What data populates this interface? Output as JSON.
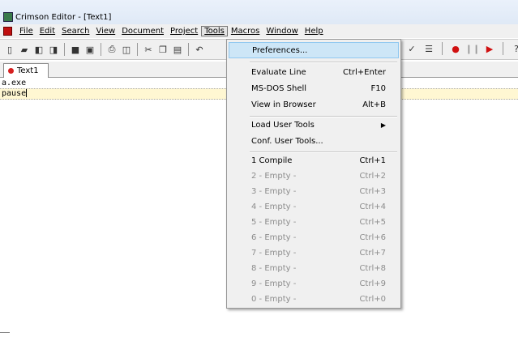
{
  "window": {
    "title": "Crimson Editor - [Text1]"
  },
  "menubar": {
    "items": [
      "File",
      "Edit",
      "Search",
      "View",
      "Document",
      "Project",
      "Tools",
      "Macros",
      "Window",
      "Help"
    ]
  },
  "tab": {
    "label": "Text1"
  },
  "editor": {
    "lines": [
      "a.exe",
      "pause"
    ]
  },
  "tools_menu": {
    "items": [
      {
        "label": "Preferences...",
        "shortcut": ""
      },
      {
        "label": "Evaluate Line",
        "shortcut": "Ctrl+Enter"
      },
      {
        "label": "MS-DOS Shell",
        "shortcut": "F10"
      },
      {
        "label": "View in Browser",
        "shortcut": "Alt+B"
      },
      {
        "label": "Load User Tools",
        "shortcut": ""
      },
      {
        "label": "Conf. User Tools...",
        "shortcut": ""
      },
      {
        "label": "1 Compile",
        "shortcut": "Ctrl+1"
      },
      {
        "label": "2 - Empty -",
        "shortcut": "Ctrl+2"
      },
      {
        "label": "3 - Empty -",
        "shortcut": "Ctrl+3"
      },
      {
        "label": "4 - Empty -",
        "shortcut": "Ctrl+4"
      },
      {
        "label": "5 - Empty -",
        "shortcut": "Ctrl+5"
      },
      {
        "label": "6 - Empty -",
        "shortcut": "Ctrl+6"
      },
      {
        "label": "7 - Empty -",
        "shortcut": "Ctrl+7"
      },
      {
        "label": "8 - Empty -",
        "shortcut": "Ctrl+8"
      },
      {
        "label": "9 - Empty -",
        "shortcut": "Ctrl+9"
      },
      {
        "label": "0 - Empty -",
        "shortcut": "Ctrl+0"
      }
    ]
  },
  "colors": {
    "highlight": "#cde6f7",
    "current_line": "#fff7d2",
    "disabled_text": "#8c8c8c"
  }
}
